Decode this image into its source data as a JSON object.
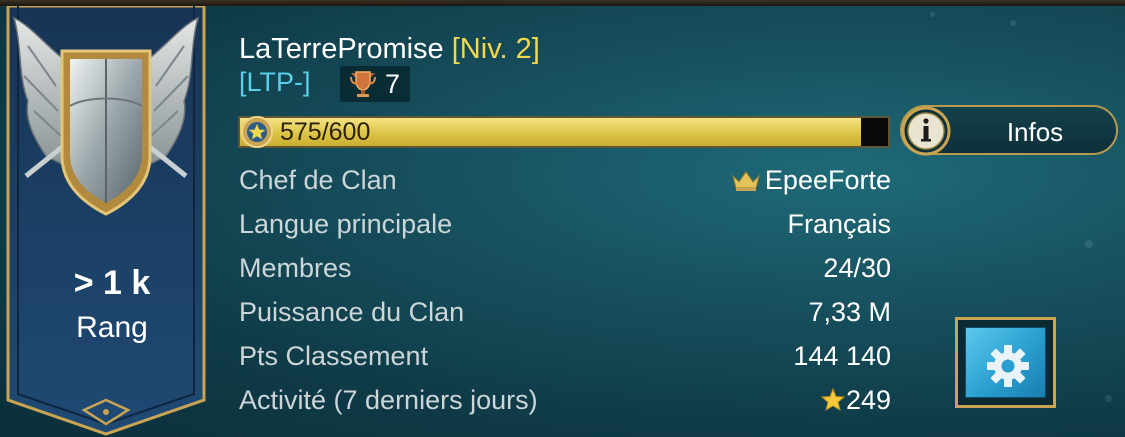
{
  "rank": {
    "value": "> 1 k",
    "label": "Rang"
  },
  "clan": {
    "name": "LaTerrePromise",
    "level": "[Niv. 2]",
    "tag": "[LTP-]",
    "trophies": "7"
  },
  "xp": {
    "text": "575/600",
    "current": 575,
    "max": 600
  },
  "infos_button": {
    "label": "Infos",
    "icon": "info-icon"
  },
  "rows": [
    {
      "label": "Chef de Clan",
      "value": "EpeeForte",
      "icon": "crown-icon"
    },
    {
      "label": "Langue principale",
      "value": "Français"
    },
    {
      "label": "Membres",
      "value": "24/30"
    },
    {
      "label": "Puissance du Clan",
      "value": "7,33 M"
    },
    {
      "label": "Pts Classement",
      "value": "144 140"
    },
    {
      "label": "Activité (7 derniers jours)",
      "value": "249",
      "icon": "star-icon"
    }
  ],
  "settings_button": {
    "icon": "gear-icon"
  },
  "colors": {
    "gold": "#f3d84b",
    "tag_blue": "#5ad0e8",
    "background": "#17505e",
    "banner": "#1b3a63"
  }
}
